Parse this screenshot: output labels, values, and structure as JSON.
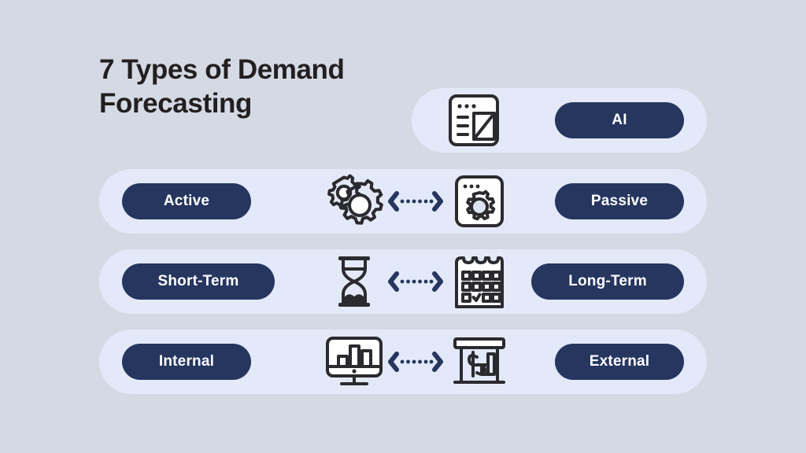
{
  "page": {
    "title": "7 Types of Demand\nForecasting",
    "background_color": "#d4d9e4",
    "row_color": "#e3e9f8",
    "pill_color": "#26365f",
    "pill_text_color": "#ffffff",
    "icon_stroke_color": "#2b2b2f",
    "arrow_color": "#26365f"
  },
  "rows": [
    {
      "id": "ai",
      "layout": "single",
      "label": "AI",
      "icon_name": "ai-window-icon"
    },
    {
      "id": "active-passive",
      "layout": "pair",
      "left_label": "Active",
      "right_label": "Passive",
      "left_icon_name": "gears-icon",
      "right_icon_name": "window-gear-icon",
      "connector_name": "double-arrow-dotted"
    },
    {
      "id": "short-long-term",
      "layout": "pair",
      "left_label": "Short-Term",
      "right_label": "Long-Term",
      "left_icon_name": "hourglass-icon",
      "right_icon_name": "calendar-check-icon",
      "connector_name": "double-arrow-dotted"
    },
    {
      "id": "internal-external",
      "layout": "pair",
      "left_label": "Internal",
      "right_label": "External",
      "left_icon_name": "monitor-bar-chart-icon",
      "right_icon_name": "market-stall-dollar-chart-icon",
      "connector_name": "double-arrow-dotted"
    }
  ]
}
